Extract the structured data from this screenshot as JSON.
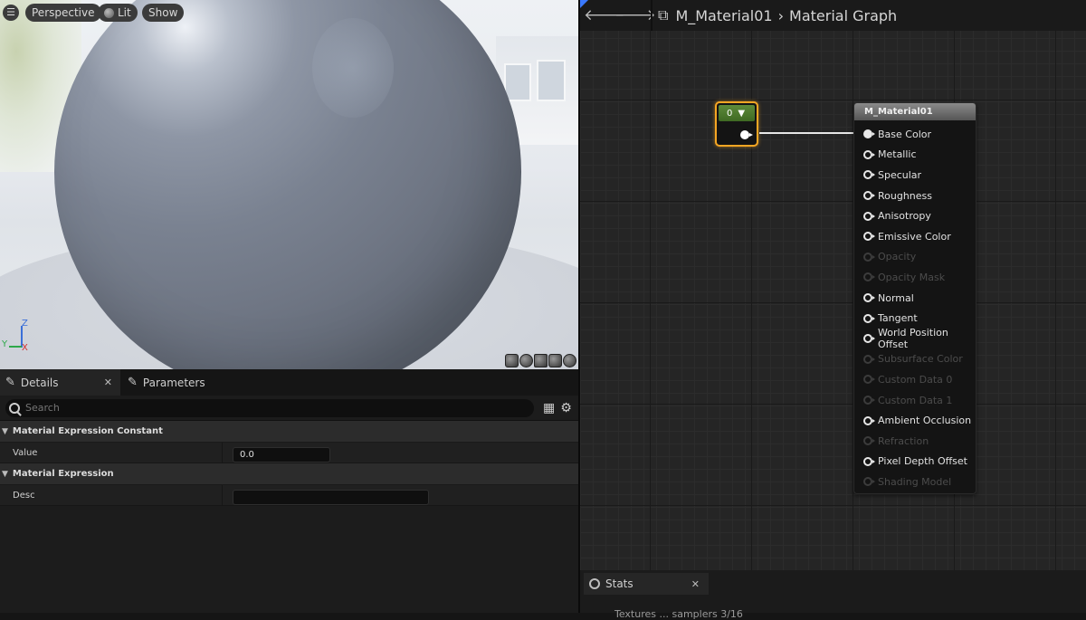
{
  "viewport": {
    "perspective_label": "Perspective",
    "lit_label": "Lit",
    "show_label": "Show",
    "axis": {
      "z": "Z",
      "y": "Y",
      "x": "X"
    }
  },
  "details": {
    "tabs": [
      {
        "label": "Details",
        "close": "✕"
      },
      {
        "label": "Parameters"
      }
    ],
    "search_placeholder": "Search",
    "sections": [
      {
        "title": "Material Expression Constant",
        "rows": [
          {
            "name": "Value",
            "value": "0.0"
          }
        ]
      },
      {
        "title": "Material Expression",
        "rows": [
          {
            "name": "Desc",
            "value": ""
          }
        ]
      }
    ]
  },
  "graph": {
    "breadcrumb": [
      "M_Material01",
      "Material Graph"
    ],
    "constant_node": {
      "value": "0"
    },
    "material_node": {
      "title": "M_Material01",
      "inputs": [
        {
          "label": "Base Color",
          "enabled": true,
          "connected": true
        },
        {
          "label": "Metallic",
          "enabled": true
        },
        {
          "label": "Specular",
          "enabled": true
        },
        {
          "label": "Roughness",
          "enabled": true
        },
        {
          "label": "Anisotropy",
          "enabled": true
        },
        {
          "label": "Emissive Color",
          "enabled": true
        },
        {
          "label": "Opacity",
          "enabled": false
        },
        {
          "label": "Opacity Mask",
          "enabled": false
        },
        {
          "label": "Normal",
          "enabled": true
        },
        {
          "label": "Tangent",
          "enabled": true
        },
        {
          "label": "World Position Offset",
          "enabled": true
        },
        {
          "label": "Subsurface Color",
          "enabled": false
        },
        {
          "label": "Custom Data 0",
          "enabled": false
        },
        {
          "label": "Custom Data 1",
          "enabled": false
        },
        {
          "label": "Ambient Occlusion",
          "enabled": true
        },
        {
          "label": "Refraction",
          "enabled": false
        },
        {
          "label": "Pixel Depth Offset",
          "enabled": true
        },
        {
          "label": "Shading Model",
          "enabled": false
        }
      ]
    },
    "stats": {
      "tab_label": "Stats",
      "close": "✕",
      "text": "Textures ... samplers 3/16"
    }
  },
  "colors": {
    "selection": "#f5a623",
    "constant_header": "#5d8a3a",
    "accent_blue": "#3a79ff"
  },
  "icons": [
    "menu-icon",
    "lit-sphere-icon",
    "details-pencil-icon",
    "parameters-pencil-icon",
    "search-icon",
    "table-view-icon",
    "settings-gear-icon",
    "back-arrow-icon",
    "forward-arrow-icon",
    "blueprint-graph-icon",
    "stats-icon"
  ]
}
